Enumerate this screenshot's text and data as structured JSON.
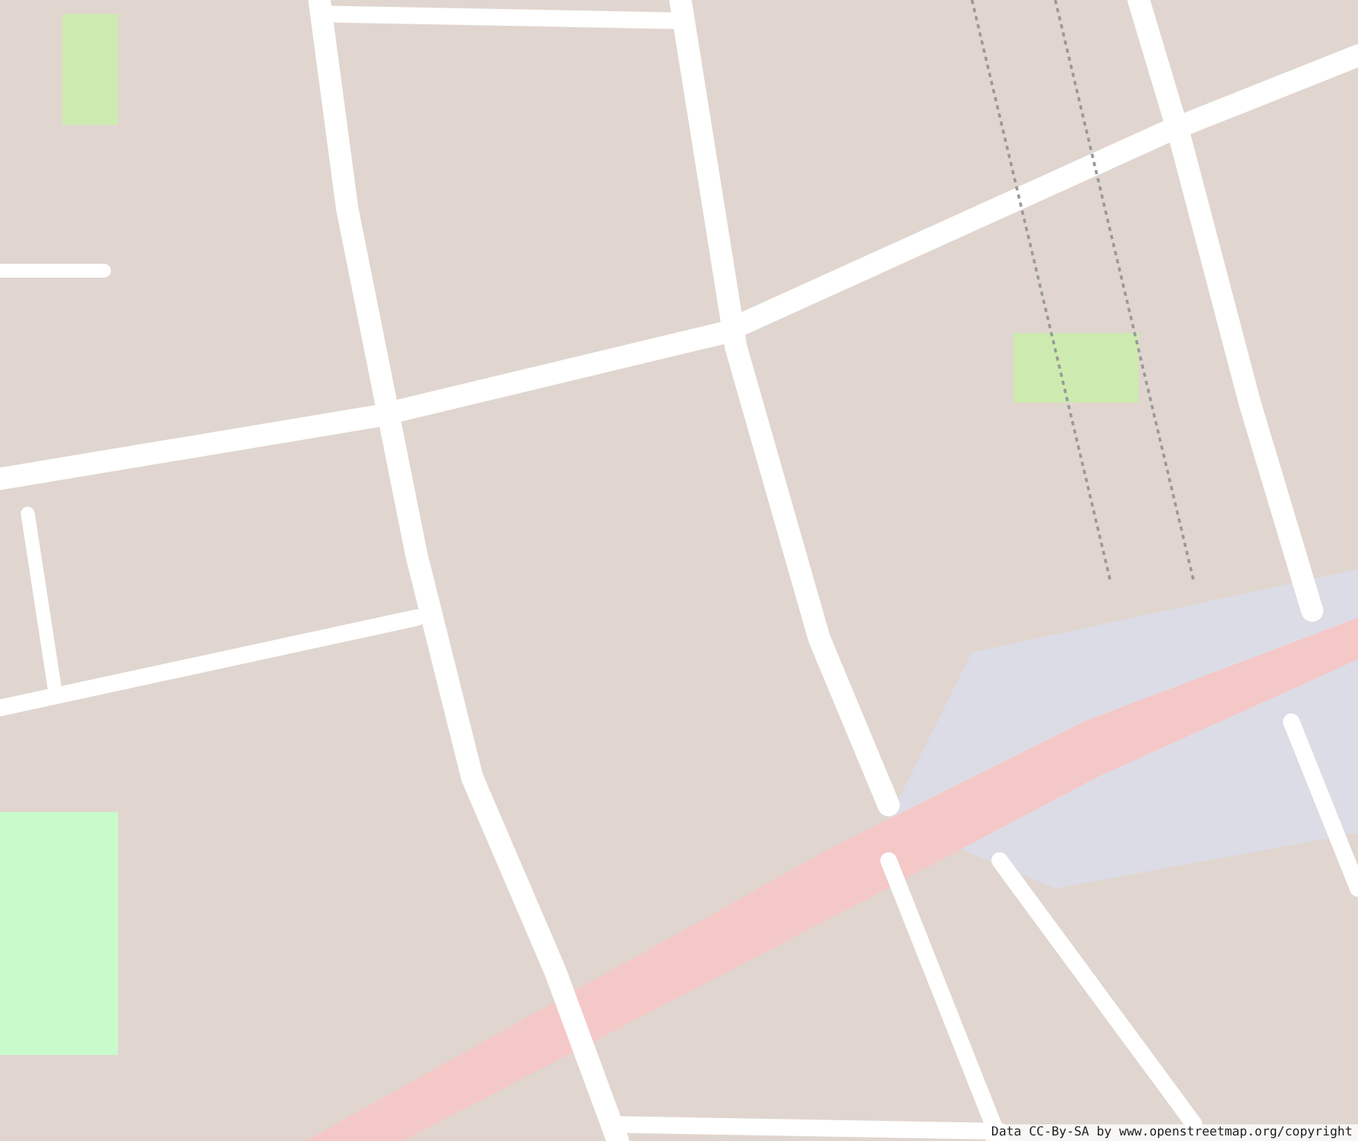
{
  "attribution": "Data CC-By-SA by www.openstreetmap.org/copyright"
}
